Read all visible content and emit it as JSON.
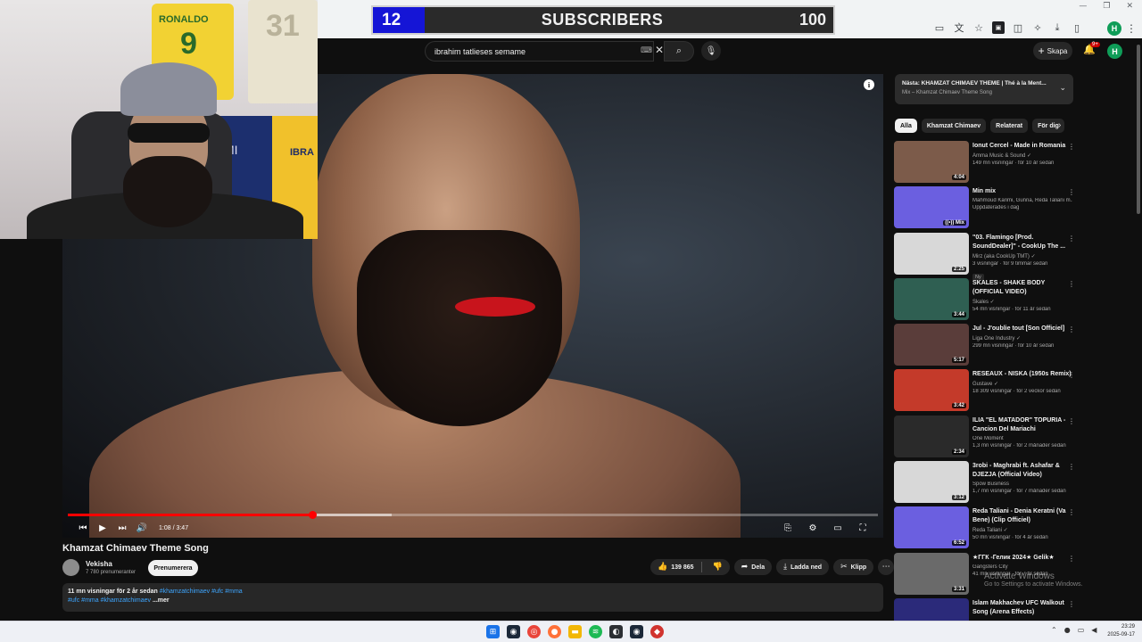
{
  "counter": {
    "current": "12",
    "label": "SUBSCRIBERS",
    "goal": "100"
  },
  "search": {
    "query": "ibrahim tatlieses semame"
  },
  "header": {
    "create_label": "Skapa",
    "notif_badge": "9+",
    "avatar_letter": "H"
  },
  "browser": {
    "profile_letter": "H"
  },
  "player": {
    "time": "1:08 / 3:47",
    "progress_fraction": 0.302,
    "buffered_fraction": 0.4
  },
  "video": {
    "title": "Khamzat Chimaev Theme Song",
    "channel": "Vekisha",
    "subscribers": "7 780 prenumeranter",
    "subscribe_label": "Prenumerera",
    "likes": "139 865",
    "share_label": "Dela",
    "download_label": "Ladda ned",
    "clip_label": "Klipp",
    "desc_meta": "11 mn visningar  för 2 år sedan",
    "desc_tags_line1": "#khamzatchimaev #ufc #mma",
    "desc_tags_line2": "#ufc #mma #khamzatchimaev",
    "desc_more": "...mer"
  },
  "next_up": {
    "title": "Nästa: KHAMZAT CHIMAEV THEME | Thé à la Ment...",
    "subtitle": "Mix – Khamzat Chimaev Theme Song"
  },
  "chips": [
    {
      "label": "Alla",
      "active": true
    },
    {
      "label": "Khamzat Chimaev",
      "active": false
    },
    {
      "label": "Relaterat",
      "active": false
    },
    {
      "label": "För dig",
      "active": false
    }
  ],
  "recommendations": [
    {
      "title": "Ionut Cercel - Made in Romania",
      "channel": "Amma Music & Sound ✓",
      "stats": "149 mn visningar · för 10 år sedan",
      "duration": "4:04",
      "thumb": "#7c5b4a"
    },
    {
      "title": "Min mix",
      "channel": "Mahmoud Karimi, Gunna, Reda Taliani m...",
      "stats": "Uppdaterades i dag",
      "duration": "((•)) Mix",
      "thumb": "#6b5fe0"
    },
    {
      "title": "\"03. Flamingo [Prod. SoundDealer]\" - CookUp The ...",
      "channel": "Mirz (aka CookUp TMT) ✓",
      "stats": "3 visningar · för 9 timmar sedan",
      "duration": "2:25",
      "badge": "Ny",
      "thumb": "#d8d8d8"
    },
    {
      "title": "SKALES - SHAKE BODY (OFFICIAL VIDEO)",
      "channel": "Skales ✓",
      "stats": "54 mn visningar · för 11 år sedan",
      "duration": "3:44",
      "thumb": "#2f5f52"
    },
    {
      "title": "Jul - J'oublie tout [Son Officiel]",
      "channel": "Liga One Industry ✓",
      "stats": "299 mn visningar · för 10 år sedan",
      "duration": "5:17",
      "thumb": "#5a3d3a"
    },
    {
      "title": "RESEAUX - NISKA (1950s Remix)",
      "channel": "Gustave ✓",
      "stats": "18 309 visningar · för 2 veckor sedan",
      "duration": "3:42",
      "thumb": "#c43a2a"
    },
    {
      "title": "ILIA \"EL MATADOR\" TOPURIA - Cancion Del Mariachi",
      "channel": "One Moment",
      "stats": "1,3 mn visningar · för 2 månader sedan",
      "duration": "2:34",
      "thumb": "#2a2a2a"
    },
    {
      "title": "3robi - Maghrabi ft. Ashafar & DJEZJA (Official Video)",
      "channel": "Spow Business",
      "stats": "1,7 mn visningar · för 7 månader sedan",
      "duration": "3:12",
      "thumb": "#d8d8d8"
    },
    {
      "title": "Reda Taliani - Denia Keratni (Va Bene) (Clip Officiel)",
      "channel": "Reda Taliani ✓",
      "stats": "50 mn visningar · för 4 år sedan",
      "duration": "6:52",
      "thumb": "#6b5fe0"
    },
    {
      "title": "★ГГК -Гелик 2024★ Gelik★",
      "channel": "Gangsters City",
      "stats": "41 mn visningar · för 7 år sedan",
      "duration": "3:31",
      "thumb": "#6a6a6a"
    },
    {
      "title": "Islam Makhachev UFC Walkout Song (Arena Effects)",
      "channel": "",
      "stats": "",
      "duration": "",
      "thumb": "#2b2a7a"
    }
  ],
  "watermark": {
    "line1": "Activate Windows",
    "line2": "Go to Settings to activate Windows."
  },
  "clock": {
    "time": "23:29",
    "date": "2025-09-17"
  }
}
